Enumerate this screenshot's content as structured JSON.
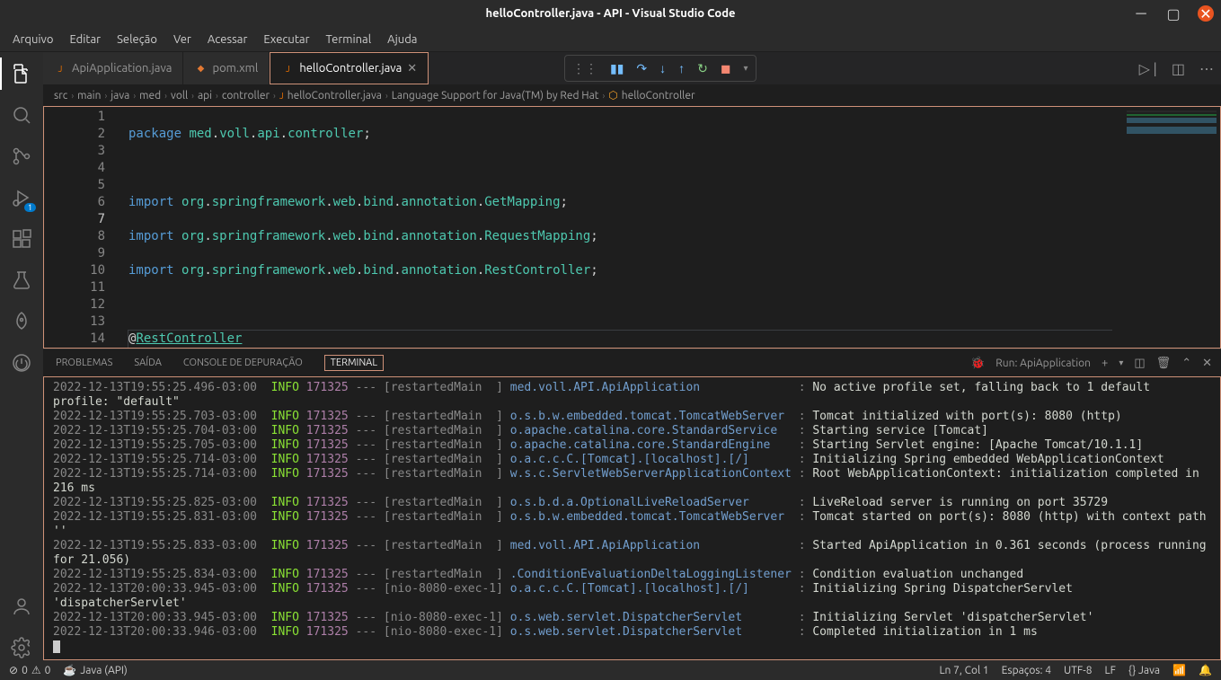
{
  "window": {
    "title": "helloController.java - API - Visual Studio Code"
  },
  "menu": [
    "Arquivo",
    "Editar",
    "Seleção",
    "Ver",
    "Acessar",
    "Executar",
    "Terminal",
    "Ajuda"
  ],
  "tabs": [
    {
      "label": "ApiApplication.java",
      "type": "java",
      "active": false
    },
    {
      "label": "pom.xml",
      "type": "xml",
      "active": false
    },
    {
      "label": "helloController.java",
      "type": "java",
      "active": true
    }
  ],
  "breadcrumb": [
    "src",
    "main",
    "java",
    "med",
    "voll",
    "api",
    "controller",
    "helloController.java",
    "Language Support for Java(TM) by Red Hat",
    "helloController"
  ],
  "code": {
    "lines": [
      "1",
      "2",
      "3",
      "4",
      "5",
      "6",
      "7",
      "8",
      "9",
      "10",
      "11",
      "12",
      "13",
      "14"
    ]
  },
  "panel": {
    "tabs": [
      "PROBLEMAS",
      "SAÍDA",
      "CONSOLE DE DEPURAÇÃO",
      "TERMINAL"
    ],
    "active": "TERMINAL",
    "run": "Run: ApiApplication"
  },
  "terminal": [
    {
      "ts": "2022-12-13T19:55:25.496-03:00",
      "lvl": "INFO",
      "pid": "171325",
      "thr": "restartedMain",
      "logger": "med.voll.API.ApiApplication",
      "msg": "No active profile set, falling back to 1 default profile: \"default\""
    },
    {
      "ts": "2022-12-13T19:55:25.703-03:00",
      "lvl": "INFO",
      "pid": "171325",
      "thr": "restartedMain",
      "logger": "o.s.b.w.embedded.tomcat.TomcatWebServer",
      "msg": "Tomcat initialized with port(s): 8080 (http)"
    },
    {
      "ts": "2022-12-13T19:55:25.704-03:00",
      "lvl": "INFO",
      "pid": "171325",
      "thr": "restartedMain",
      "logger": "o.apache.catalina.core.StandardService",
      "msg": "Starting service [Tomcat]"
    },
    {
      "ts": "2022-12-13T19:55:25.705-03:00",
      "lvl": "INFO",
      "pid": "171325",
      "thr": "restartedMain",
      "logger": "o.apache.catalina.core.StandardEngine",
      "msg": "Starting Servlet engine: [Apache Tomcat/10.1.1]"
    },
    {
      "ts": "2022-12-13T19:55:25.714-03:00",
      "lvl": "INFO",
      "pid": "171325",
      "thr": "restartedMain",
      "logger": "o.a.c.c.C.[Tomcat].[localhost].[/]",
      "msg": "Initializing Spring embedded WebApplicationContext"
    },
    {
      "ts": "2022-12-13T19:55:25.714-03:00",
      "lvl": "INFO",
      "pid": "171325",
      "thr": "restartedMain",
      "logger": "w.s.c.ServletWebServerApplicationContext",
      "msg": "Root WebApplicationContext: initialization completed in 216 ms"
    },
    {
      "ts": "2022-12-13T19:55:25.825-03:00",
      "lvl": "INFO",
      "pid": "171325",
      "thr": "restartedMain",
      "logger": "o.s.b.d.a.OptionalLiveReloadServer",
      "msg": "LiveReload server is running on port 35729"
    },
    {
      "ts": "2022-12-13T19:55:25.831-03:00",
      "lvl": "INFO",
      "pid": "171325",
      "thr": "restartedMain",
      "logger": "o.s.b.w.embedded.tomcat.TomcatWebServer",
      "msg": "Tomcat started on port(s): 8080 (http) with context path ''"
    },
    {
      "ts": "2022-12-13T19:55:25.833-03:00",
      "lvl": "INFO",
      "pid": "171325",
      "thr": "restartedMain",
      "logger": "med.voll.API.ApiApplication",
      "msg": "Started ApiApplication in 0.361 seconds (process running for 21.056)"
    },
    {
      "ts": "2022-12-13T19:55:25.834-03:00",
      "lvl": "INFO",
      "pid": "171325",
      "thr": "restartedMain",
      "logger": ".ConditionEvaluationDeltaLoggingListener",
      "msg": "Condition evaluation unchanged"
    },
    {
      "ts": "2022-12-13T20:00:33.945-03:00",
      "lvl": "INFO",
      "pid": "171325",
      "thr": "nio-8080-exec-1",
      "logger": "o.a.c.c.C.[Tomcat].[localhost].[/]",
      "msg": "Initializing Spring DispatcherServlet 'dispatcherServlet'"
    },
    {
      "ts": "2022-12-13T20:00:33.945-03:00",
      "lvl": "INFO",
      "pid": "171325",
      "thr": "nio-8080-exec-1",
      "logger": "o.s.web.servlet.DispatcherServlet",
      "msg": "Initializing Servlet 'dispatcherServlet'"
    },
    {
      "ts": "2022-12-13T20:00:33.946-03:00",
      "lvl": "INFO",
      "pid": "171325",
      "thr": "nio-8080-exec-1",
      "logger": "o.s.web.servlet.DispatcherServlet",
      "msg": "Completed initialization in 1 ms"
    }
  ],
  "status": {
    "errors": "0",
    "warnings": "0",
    "java": "Java (API)",
    "pos": "Ln 7, Col 1",
    "spaces": "Espaços: 4",
    "enc": "UTF-8",
    "eol": "LF",
    "lang": "{} Java"
  },
  "activity_badge": "1"
}
